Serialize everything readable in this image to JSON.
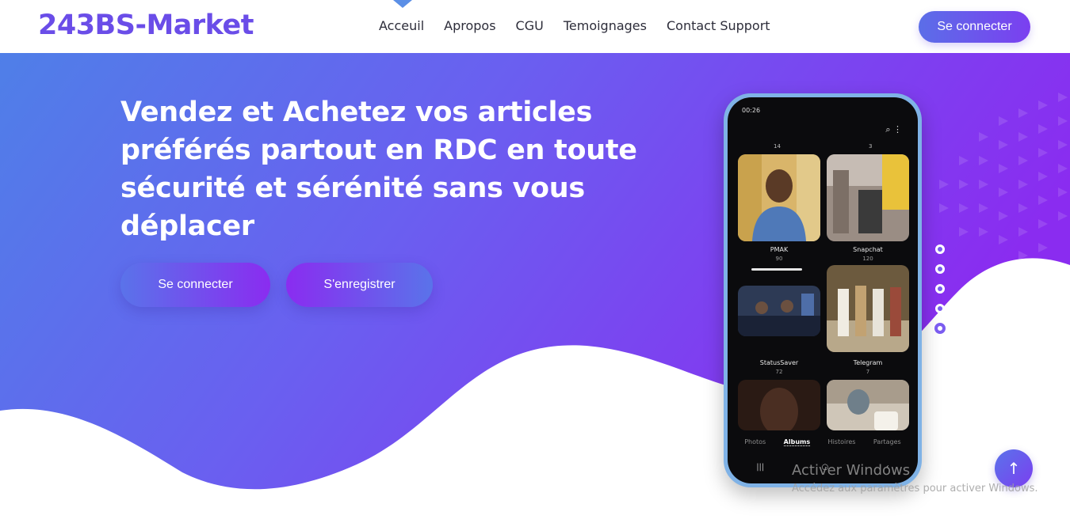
{
  "brand": {
    "name": "243BS-Market"
  },
  "nav": {
    "items": [
      {
        "label": "Acceuil",
        "active": true
      },
      {
        "label": "Apropos"
      },
      {
        "label": "CGU"
      },
      {
        "label": "Temoignages"
      },
      {
        "label": "Contact Support"
      }
    ],
    "login_label": "Se connecter"
  },
  "hero": {
    "headline": "Vendez et Achetez vos articles préférés partout en RDC en toute sécurité et sérénité sans vous déplacer",
    "connect_label": "Se connecter",
    "register_label": "S'enregistrer",
    "slider": {
      "slides": 5,
      "active_index": 4
    }
  },
  "phone": {
    "time": "00:26",
    "counts_top": [
      "14",
      "3"
    ],
    "albums": [
      {
        "name": "PMAK",
        "count": "90"
      },
      {
        "name": "Snapchat",
        "count": "120"
      },
      {
        "name": "StatusSaver",
        "count": "72"
      },
      {
        "name": "Telegram",
        "count": "7"
      }
    ],
    "tabs": [
      {
        "label": "Photos"
      },
      {
        "label": "Albums",
        "active": true
      },
      {
        "label": "Histoires"
      },
      {
        "label": "Partages"
      }
    ]
  },
  "scroll_top_icon": "arrow-up-icon",
  "watermark": {
    "title": "Activer Windows",
    "subtitle": "Accédez aux paramètres pour activer Windows."
  },
  "colors": {
    "brand": "#6a4de8",
    "gradient_start": "#4f7fe8",
    "gradient_end": "#8a2cf0"
  }
}
